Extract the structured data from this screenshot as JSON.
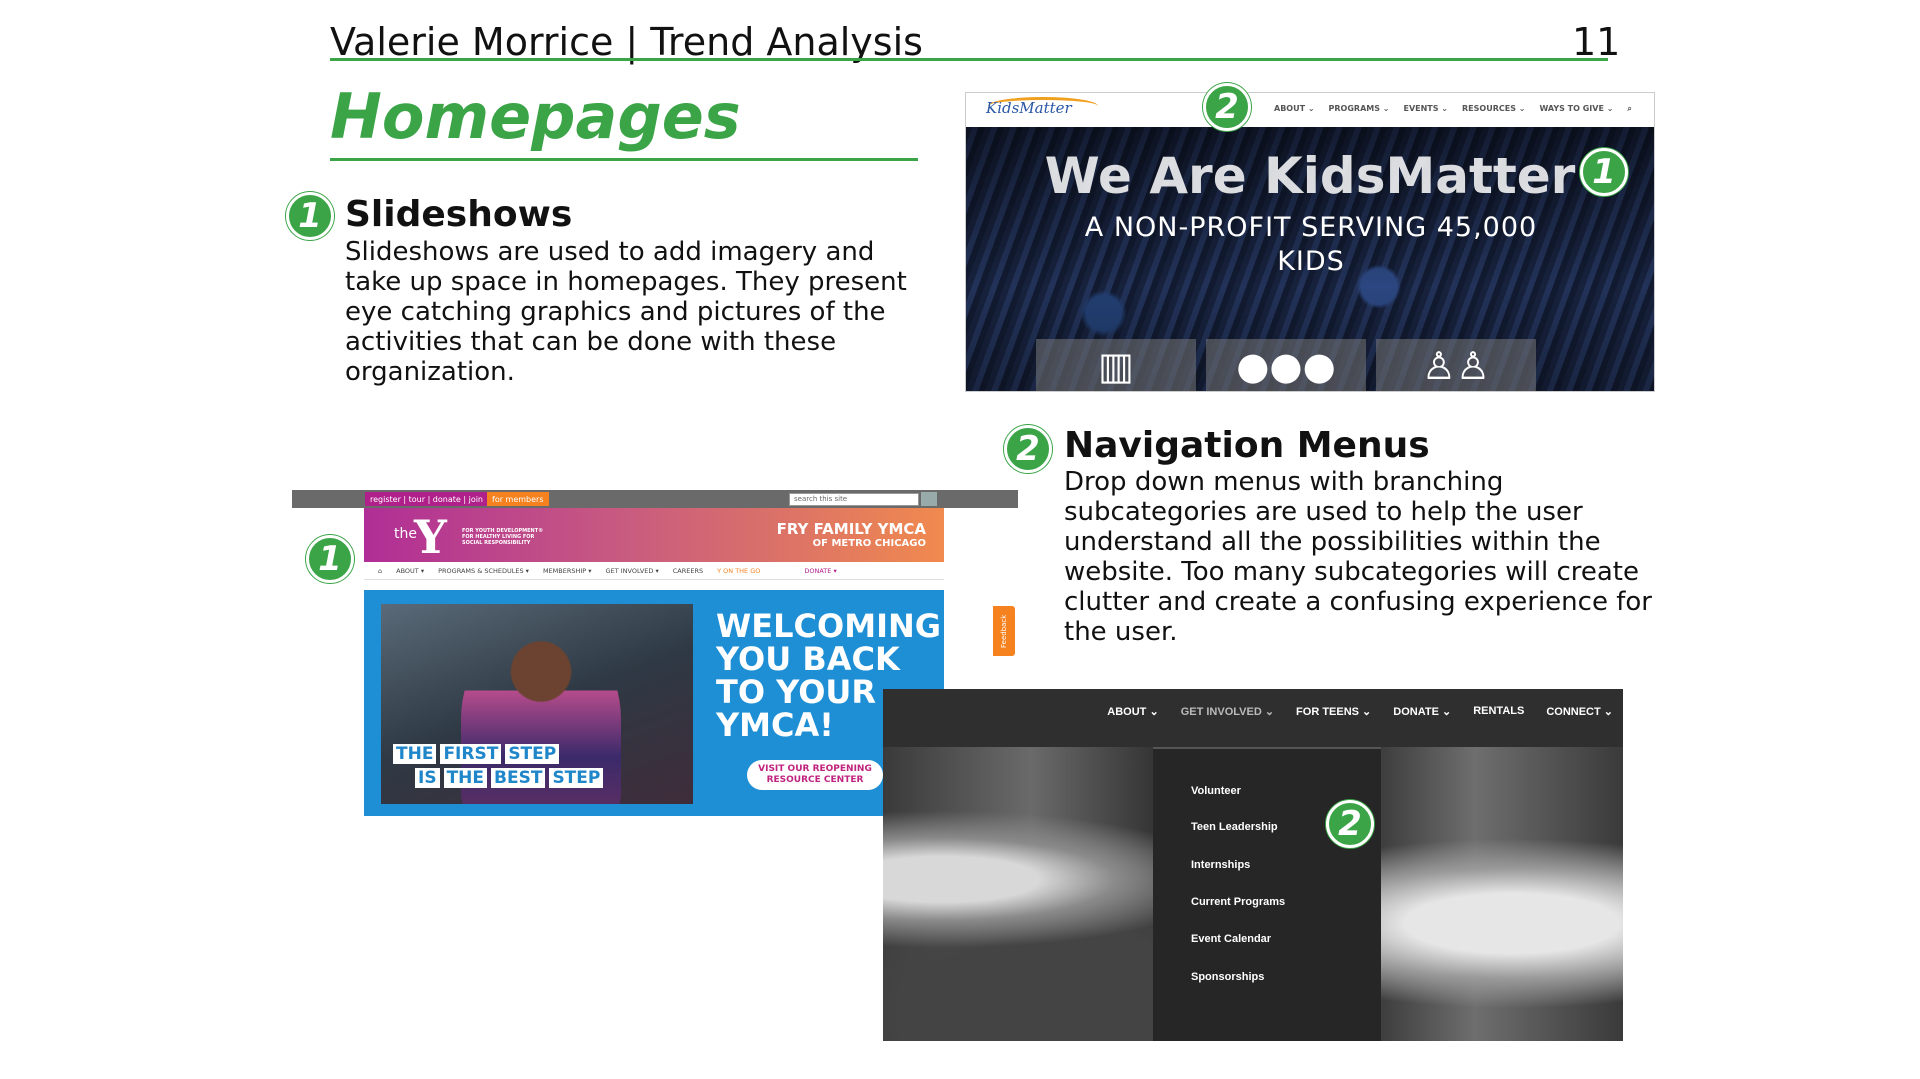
{
  "header": {
    "title": "Valerie Morrice | Trend Analysis",
    "page_number": "11"
  },
  "section_title": "Homepages",
  "colors": {
    "accent": "#3aa447"
  },
  "slideshows": {
    "badge": "1",
    "heading": "Slideshows",
    "lines": [
      "Slideshows are used to add imagery and",
      "take up space in homepages. They present",
      "eye catching graphics and pictures of the",
      "activities that can be done with these",
      "organization."
    ]
  },
  "navigation": {
    "badge": "2",
    "heading": "Navigation Menus",
    "lines": [
      "Drop down menus with branching",
      "subcategories are used to help the user",
      "understand all the possibilities within the",
      "website. Too many subcategories will create",
      "clutter and create a confusing experience for",
      "the user."
    ]
  },
  "kidsmatter": {
    "logo": "KidsMatter",
    "menu": [
      "ABOUT ⌄",
      "PROGRAMS ⌄",
      "EVENTS ⌄",
      "RESOURCES ⌄",
      "WAYS TO GIVE ⌄"
    ],
    "heading": "We Are KidsMatter",
    "subheading_line1": "A NON-PROFIT SERVING 45,000",
    "subheading_line2": "KIDS",
    "badge_nav": "2",
    "badge_slide": "1",
    "tile_icons": [
      "book-icon",
      "group-icon",
      "family-icon"
    ]
  },
  "ymca": {
    "top_links": "register | tour | donate | join",
    "members_link": "for members",
    "search_placeholder": "search this site",
    "the": "the",
    "y": "Y",
    "tagline": "FOR YOUTH DEVELOPMENT® FOR HEALTHY LIVING FOR SOCIAL RESPONSIBILITY",
    "branch_line1": "FRY FAMILY YMCA",
    "branch_line2": "OF METRO CHICAGO",
    "menu": [
      "⌂",
      "ABOUT ▾",
      "PROGRAMS & SCHEDULES ▾",
      "MEMBERSHIP ▾",
      "GET INVOLVED ▾",
      "CAREERS",
      "Y ON THE GO",
      "DONATE ▾"
    ],
    "step_row1": [
      "THE",
      "FIRST",
      "STEP"
    ],
    "step_row2": [
      "IS",
      "THE",
      "BEST",
      "STEP"
    ],
    "welcome_lines": [
      "WELCOMING",
      "YOU BACK",
      "TO YOUR",
      "YMCA!"
    ],
    "cta_line1": "VISIT OUR REOPENING",
    "cta_line2": "RESOURCE CENTER",
    "feedback": "Feedback",
    "badge": "1"
  },
  "darknav": {
    "menu": [
      "ABOUT ⌄",
      "GET INVOLVED ⌄",
      "FOR TEENS ⌄",
      "DONATE ⌄",
      "RENTALS",
      "CONNECT ⌄"
    ],
    "dropdown": [
      "Volunteer",
      "Teen Leadership",
      "Internships",
      "Current Programs",
      "Event Calendar",
      "Sponsorships"
    ],
    "badge": "2"
  }
}
